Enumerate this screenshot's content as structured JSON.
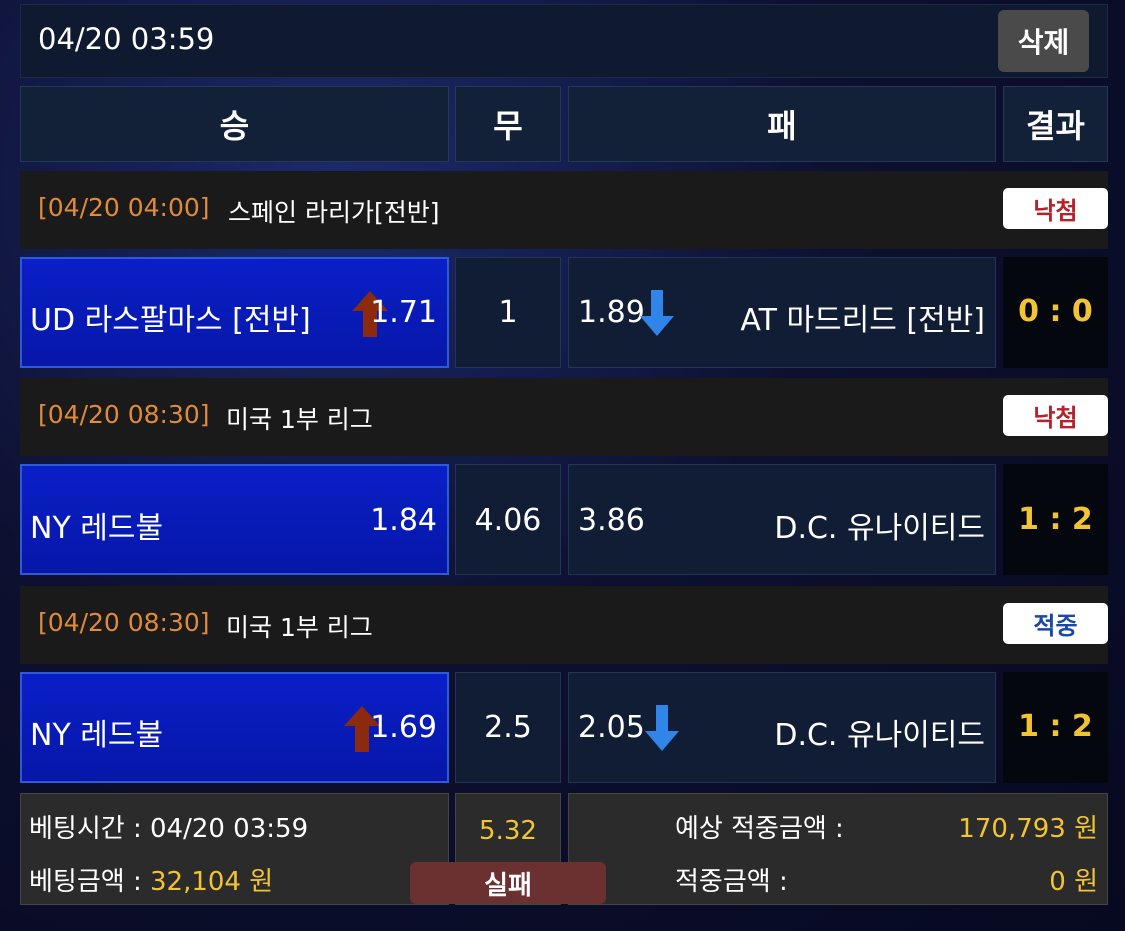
{
  "header": {
    "datetime": "04/20 03:59",
    "delete_label": "삭제"
  },
  "columns": {
    "win": "승",
    "draw": "무",
    "lose": "패",
    "result": "결과"
  },
  "games": [
    {
      "time": "[04/20 04:00]",
      "league": "스페인 라리가[전반]",
      "badge": "낙첨",
      "home": "UD 라스팔마스 [전반]",
      "home_odds": "1.71",
      "home_arrow": "up",
      "draw_odds": "1",
      "away_odds": "1.89",
      "away_arrow": "down",
      "away": "AT 마드리드 [전반]",
      "score": "0 : 0"
    },
    {
      "time": "[04/20 08:30]",
      "league": "미국 1부 리그",
      "badge": "낙첨",
      "home": "NY 레드불",
      "home_odds": "1.84",
      "draw_odds": "4.06",
      "away_odds": "3.86",
      "away": "D.C. 유나이티드",
      "score": "1 : 2"
    },
    {
      "time": "[04/20 08:30]",
      "league": "미국 1부 리그",
      "badge": "적중",
      "home": "NY 레드불",
      "home_odds": "1.69",
      "home_arrow": "up",
      "draw_odds": "2.5",
      "away_odds": "2.05",
      "away_arrow": "down",
      "away": "D.C. 유나이티드",
      "score": "1 : 2"
    }
  ],
  "footer": {
    "bet_time_label": "베팅시간 : ",
    "bet_time": "04/20 03:59",
    "bet_amount_label": "베팅금액 : ",
    "bet_amount": "32,104 원",
    "total_odds": "5.32",
    "status": "실패",
    "expected_label": "예상 적중금액 :",
    "expected_amount": "170,793 원",
    "win_label": "적중금액 :",
    "win_amount": "0 원"
  },
  "colors": {
    "time_orange": "#e08a3a",
    "score_yellow": "#f2c433",
    "up_arrow": "#8b2a0c",
    "down_arrow": "#2f86e8",
    "badge_lose": "#b8202a",
    "badge_win": "#1a47a8"
  }
}
